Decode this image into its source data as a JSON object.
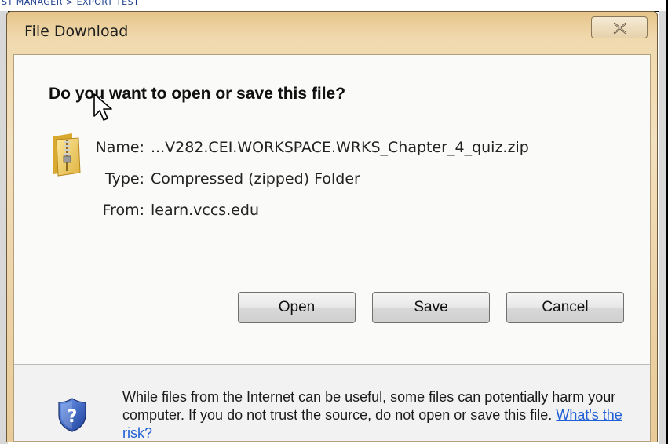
{
  "background_app": {
    "title_fragment": "ST MANAGER > EXPORT TEST"
  },
  "window": {
    "title": "File Download",
    "close_icon": "close-icon"
  },
  "dialog": {
    "question": "Do you want to open or save this file?",
    "file": {
      "icon": "zip-folder-icon",
      "name_label": "Name:",
      "name_value": "...V282.CEI.WORKSPACE.WRKS_Chapter_4_quiz.zip",
      "type_label": "Type:",
      "type_value": "Compressed (zipped) Folder",
      "from_label": "From:",
      "from_value": "learn.vccs.edu"
    },
    "buttons": {
      "open": "Open",
      "save": "Save",
      "cancel": "Cancel"
    },
    "warning": {
      "icon": "shield-question-icon",
      "text": "While files from the Internet can be useful, some files can potentially harm your computer. If you do not trust the source, do not open or save this file.",
      "link": "What's the risk?"
    }
  },
  "colors": {
    "frame": "#ecd2a5",
    "link": "#1f5fd6",
    "client_bg": "#fafaf8",
    "bottom_bg": "#f2f2f2"
  }
}
